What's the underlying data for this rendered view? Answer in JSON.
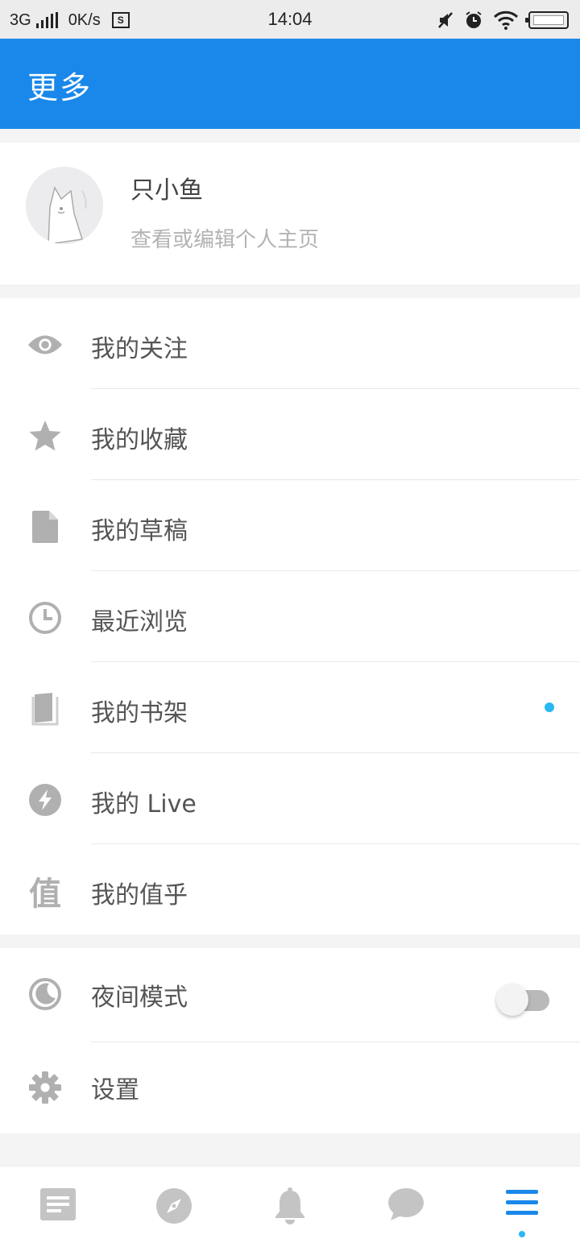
{
  "status_bar": {
    "network": "3G",
    "speed": "0K/s",
    "s_badge": "S",
    "time": "14:04"
  },
  "app_bar": {
    "title": "更多"
  },
  "profile": {
    "name": "只小鱼",
    "subtitle": "查看或编辑个人主页"
  },
  "menu": {
    "items": [
      {
        "icon": "eye-icon",
        "label": "我的关注"
      },
      {
        "icon": "star-icon",
        "label": "我的收藏"
      },
      {
        "icon": "document-icon",
        "label": "我的草稿"
      },
      {
        "icon": "clock-icon",
        "label": "最近浏览"
      },
      {
        "icon": "book-icon",
        "label": "我的书架",
        "has_new_dot": true
      },
      {
        "icon": "lightning-icon",
        "label": "我的 Live"
      },
      {
        "icon": "zhi-icon",
        "label": "我的值乎",
        "icon_text": "值"
      }
    ]
  },
  "settings": {
    "night_mode_label": "夜间模式",
    "night_mode_on": false,
    "settings_label": "设置"
  },
  "bottom_nav": {
    "items": [
      {
        "icon": "feed-icon",
        "active": false
      },
      {
        "icon": "compass-icon",
        "active": false
      },
      {
        "icon": "bell-icon",
        "active": false
      },
      {
        "icon": "chat-bubble-icon",
        "active": false
      },
      {
        "icon": "menu-icon",
        "active": true
      }
    ]
  },
  "colors": {
    "accent": "#1a88ea",
    "dot": "#2ab8f2",
    "icon_gray": "#b0b0b0"
  }
}
